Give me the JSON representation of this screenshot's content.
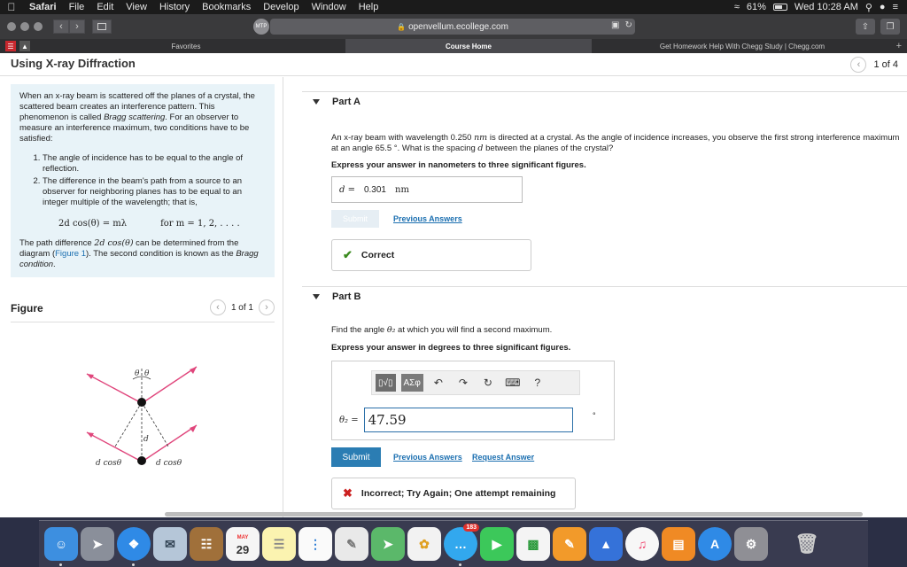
{
  "menubar": {
    "apple": "",
    "items": [
      "Safari",
      "File",
      "Edit",
      "View",
      "History",
      "Bookmarks",
      "Develop",
      "Window",
      "Help"
    ],
    "battery": "61%",
    "clock": "Wed 10:28 AM"
  },
  "toolbar": {
    "back": "‹",
    "forward": "›",
    "extension_label": "MTP",
    "url": "openvellum.ecollege.com",
    "lock": "🔒"
  },
  "tabs": {
    "items": [
      "Favorites",
      "Course Home",
      "Get Homework Help With Chegg Study | Chegg.com"
    ],
    "active_index": 1,
    "plus": "+"
  },
  "page": {
    "title": "Using X-ray Diffraction",
    "pager": {
      "prev": "‹",
      "text": "1 of 4"
    }
  },
  "intro": {
    "p1_a": "When an x-ray beam is scattered off the planes of a crystal, the scattered beam creates an interference pattern. This phenomenon is called ",
    "p1_em": "Bragg scattering",
    "p1_b": ". For an observer to measure an interference maximum, two conditions have to be satisfied:",
    "list": [
      "The angle of incidence has to be equal to the angle of reflection.",
      "The difference in the beam's path from a source to an observer for neighboring planes has to be equal to an integer multiple of the wavelength; that is,"
    ],
    "formula_left": "2d cos(θ) = mλ",
    "formula_right": "for m = 1, 2, . . . .",
    "p2_a": "The path difference ",
    "p2_math": "2d cos(θ)",
    "p2_b": " can be determined from the diagram (",
    "p2_link": "Figure 1",
    "p2_c": "). The second condition is known as the ",
    "p2_em": "Bragg condition",
    "p2_d": "."
  },
  "figure": {
    "label": "Figure",
    "prev": "‹",
    "next": "›",
    "pager": "1 of 1",
    "theta_left": "θ",
    "theta_right": "θ",
    "d_label": "d",
    "dcos_left": "d cosθ",
    "dcos_right": "d cosθ"
  },
  "partA": {
    "title": "Part A",
    "question_a": "An x-ray beam with wavelength 0.250 ",
    "question_unit": "nm",
    "question_b": " is directed at a crystal. As the angle of incidence increases, you observe the first strong interference maximum at an angle 65.5 °. What is the spacing ",
    "question_d": "d",
    "question_c": " between the planes of the crystal?",
    "instruction": "Express your answer in nanometers to three significant figures.",
    "answer_label": "d =",
    "answer_value": "0.301",
    "answer_unit": "nm",
    "submit": "Submit",
    "previous_answers": "Previous Answers",
    "feedback": "Correct",
    "feedback_icon": "✔"
  },
  "partB": {
    "title": "Part B",
    "question_a": "Find the angle ",
    "question_theta": "θ₂",
    "question_b": " at which you will find a second maximum.",
    "instruction": "Express your answer in degrees to three significant figures.",
    "tool_template": "▯√▯",
    "tool_greek": "ΑΣφ",
    "undo": "↶",
    "redo": "↷",
    "reset": "↻",
    "keyboard": "⌨",
    "help": "?",
    "answer_label": "θ₂ =",
    "answer_value": "47.59",
    "degree": "°",
    "submit": "Submit",
    "previous_answers": "Previous Answers",
    "request_answer": "Request Answer",
    "feedback": "Incorrect; Try Again; One attempt remaining",
    "feedback_icon": "✖"
  },
  "dock": {
    "calendar_month": "MAY",
    "calendar_day": "29",
    "messages_badge": "183"
  }
}
